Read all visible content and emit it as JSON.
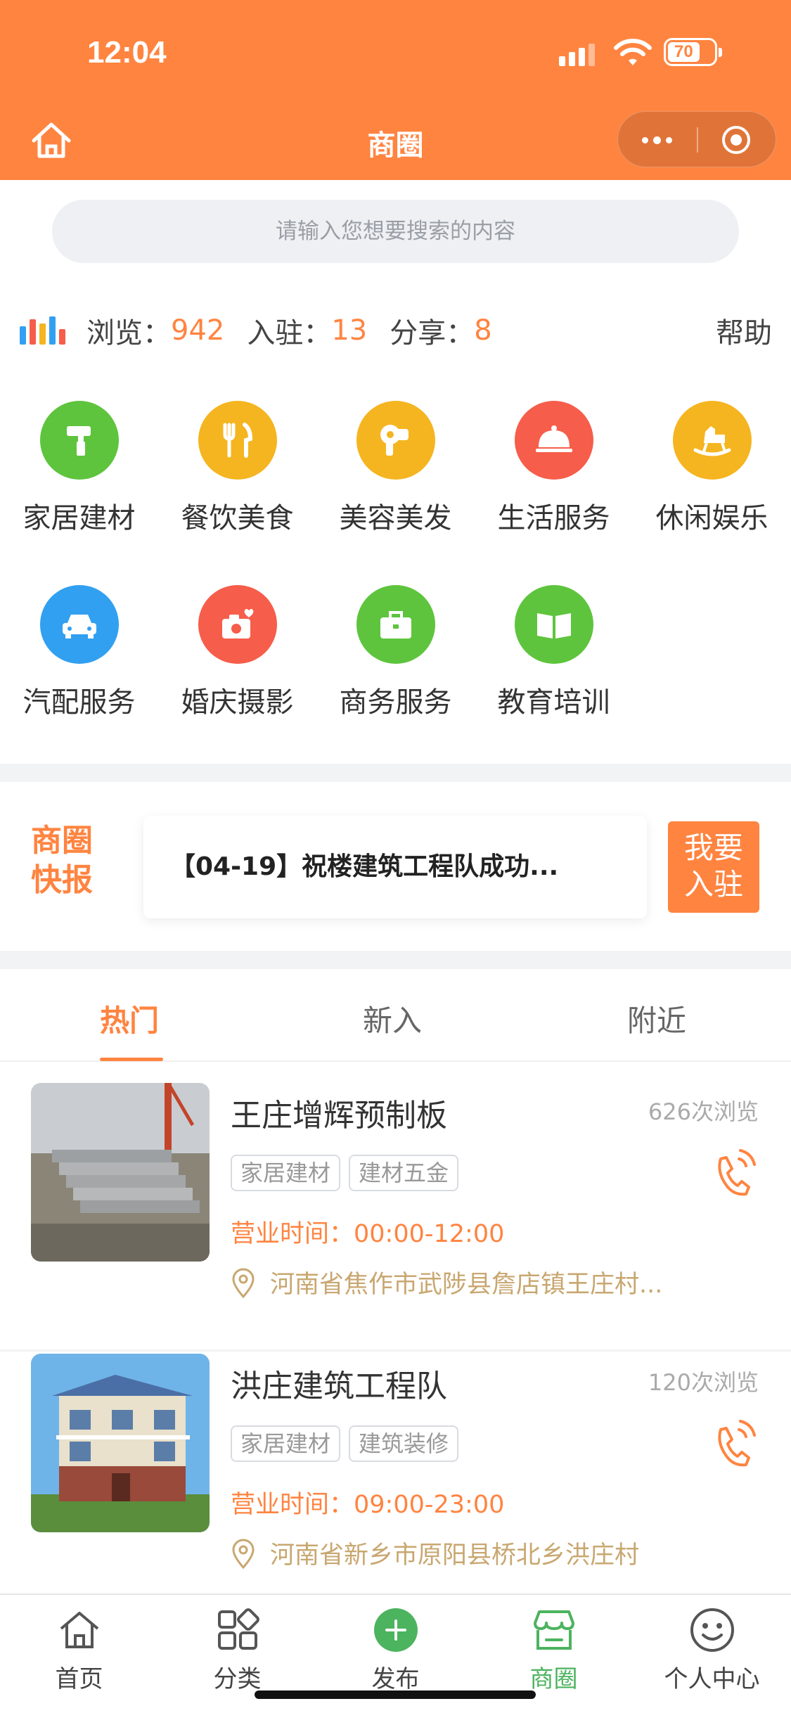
{
  "status_bar": {
    "time": "12:04",
    "battery": "70"
  },
  "nav": {
    "title": "商圈",
    "home_icon": "home-icon",
    "more_icon": "more-dots-icon",
    "close_icon": "target-circle-icon"
  },
  "search": {
    "placeholder": "请输入您想要搜索的内容"
  },
  "stats": {
    "views_label": "浏览：",
    "views_value": "942",
    "joined_label": "入驻：",
    "joined_value": "13",
    "shares_label": "分享：",
    "shares_value": "8",
    "help": "帮助"
  },
  "categories": [
    {
      "label": "家居建材",
      "icon": "paint-roller-icon",
      "color": "#5ec43d"
    },
    {
      "label": "餐饮美食",
      "icon": "fork-knife-icon",
      "color": "#f5b520"
    },
    {
      "label": "美容美发",
      "icon": "hair-dryer-icon",
      "color": "#f5b520"
    },
    {
      "label": "生活服务",
      "icon": "cloche-icon",
      "color": "#f65d4a"
    },
    {
      "label": "休闲娱乐",
      "icon": "rocking-horse-icon",
      "color": "#f5b520"
    },
    {
      "label": "汽配服务",
      "icon": "car-icon",
      "color": "#32a0f0"
    },
    {
      "label": "婚庆摄影",
      "icon": "camera-heart-icon",
      "color": "#f65d4a"
    },
    {
      "label": "商务服务",
      "icon": "briefcase-icon",
      "color": "#5ec43d"
    },
    {
      "label": "教育培训",
      "icon": "book-icon",
      "color": "#5ec43d"
    }
  ],
  "news": {
    "tag_line1": "商圈",
    "tag_line2": "快报",
    "headline": "【04-19】祝楼建筑工程队成功...",
    "join_line1": "我要",
    "join_line2": "入驻"
  },
  "tabs": [
    {
      "label": "热门",
      "active": true
    },
    {
      "label": "新入",
      "active": false
    },
    {
      "label": "附近",
      "active": false
    }
  ],
  "listings": [
    {
      "name": "王庄增辉预制板",
      "views": "626次浏览",
      "tags": [
        "家居建材",
        "建材五金"
      ],
      "hours_label": "营业时间：",
      "hours": "00:00-12:00",
      "address": "河南省焦作市武陟县詹店镇王庄村..."
    },
    {
      "name": "洪庄建筑工程队",
      "views": "120次浏览",
      "tags": [
        "家居建材",
        "建筑装修"
      ],
      "hours_label": "营业时间：",
      "hours": "09:00-23:00",
      "address": "河南省新乡市原阳县桥北乡洪庄村"
    }
  ],
  "tabbar": [
    {
      "label": "首页",
      "icon": "home-icon"
    },
    {
      "label": "分类",
      "icon": "grid-icon"
    },
    {
      "label": "发布",
      "icon": "plus-circle-icon"
    },
    {
      "label": "商圈",
      "icon": "store-icon",
      "active": true
    },
    {
      "label": "个人中心",
      "icon": "smiley-icon"
    }
  ],
  "colors": {
    "accent": "#ff8440",
    "active_tab": "#4cb35f",
    "address": "#c8a770"
  }
}
